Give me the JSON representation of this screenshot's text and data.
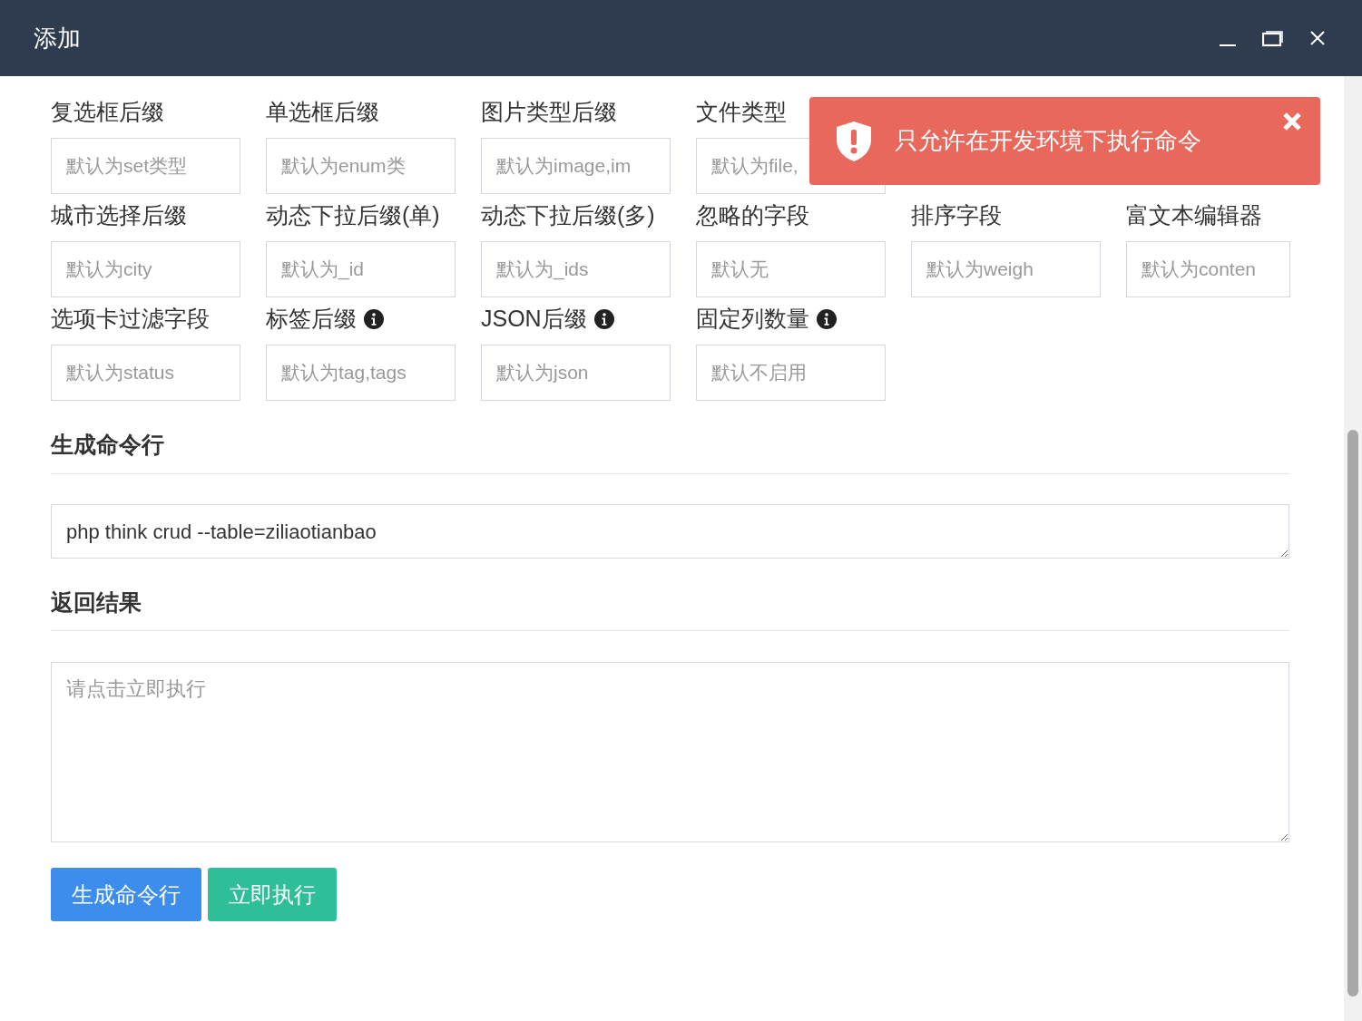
{
  "window": {
    "title": "添加"
  },
  "field_rows": [
    [
      {
        "label": "复选框后缀",
        "info": false,
        "placeholder": "默认为set类型"
      },
      {
        "label": "单选框后缀",
        "info": false,
        "placeholder": "默认为enum类"
      },
      {
        "label": "图片类型后缀",
        "info": false,
        "placeholder": "默认为image,im"
      },
      {
        "label": "文件类型",
        "info": false,
        "placeholder": "默认为file,"
      }
    ],
    [
      {
        "label": "城市选择后缀",
        "info": false,
        "placeholder": "默认为city"
      },
      {
        "label": "动态下拉后缀(单)",
        "info": false,
        "placeholder": "默认为_id"
      },
      {
        "label": "动态下拉后缀(多)",
        "info": false,
        "placeholder": "默认为_ids"
      },
      {
        "label": "忽略的字段",
        "info": false,
        "placeholder": "默认无"
      },
      {
        "label": "排序字段",
        "info": false,
        "placeholder": "默认为weigh"
      },
      {
        "label": "富文本编辑器",
        "info": false,
        "placeholder": "默认为conten"
      }
    ],
    [
      {
        "label": "选项卡过滤字段",
        "info": false,
        "placeholder": "默认为status"
      },
      {
        "label": "标签后缀",
        "info": true,
        "placeholder": "默认为tag,tags"
      },
      {
        "label": "JSON后缀",
        "info": true,
        "placeholder": "默认为json"
      },
      {
        "label": "固定列数量",
        "info": true,
        "placeholder": "默认不启用"
      }
    ]
  ],
  "command_section": {
    "heading": "生成命令行",
    "value": "php think crud --table=ziliaotianbao"
  },
  "result_section": {
    "heading": "返回结果",
    "placeholder": "请点击立即执行"
  },
  "buttons": [
    {
      "label": "生成命令行",
      "kind": "primary"
    },
    {
      "label": "立即执行",
      "kind": "success"
    }
  ],
  "toast": {
    "message": "只允许在开发环境下执行命令"
  }
}
